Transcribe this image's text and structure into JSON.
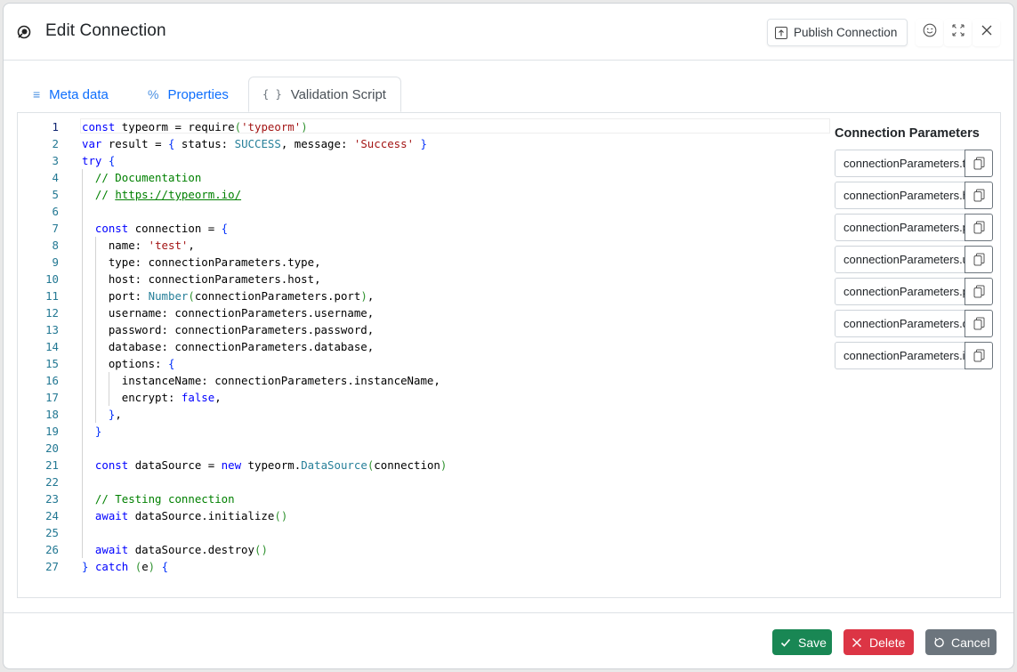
{
  "header": {
    "title": "Edit Connection",
    "title_icon": "connection-icon",
    "publish_label": "Publish Connection",
    "publish_icon": "upload-icon",
    "icons": [
      "smiley-icon",
      "fullscreen-icon",
      "close-icon"
    ]
  },
  "tabs": [
    {
      "label": "Meta data",
      "icon": "≡",
      "active": false
    },
    {
      "label": "Properties",
      "icon": "%",
      "active": false
    },
    {
      "label": "Validation Script",
      "icon": "{ }",
      "active": true
    }
  ],
  "editor": {
    "language": "javascript",
    "current_line": 1,
    "lines": [
      "const typeorm = require('typeorm')",
      "var result = { status: SUCCESS, message: 'Success' }",
      "try {",
      "  // Documentation",
      "  // https://typeorm.io/",
      "",
      "  const connection = {",
      "    name: 'test',",
      "    type: connectionParameters.type,",
      "    host: connectionParameters.host,",
      "    port: Number(connectionParameters.port),",
      "    username: connectionParameters.username,",
      "    password: connectionParameters.password,",
      "    database: connectionParameters.database,",
      "    options: {",
      "      instanceName: connectionParameters.instanceName,",
      "      encrypt: false,",
      "    },",
      "  }",
      "",
      "  const dataSource = new typeorm.DataSource(connection)",
      "",
      "  // Testing connection",
      "  await dataSource.initialize()",
      "",
      "  await dataSource.destroy()",
      "} catch (e) {"
    ]
  },
  "params": {
    "title": "Connection Parameters",
    "items": [
      "connectionParameters.type",
      "connectionParameters.host",
      "connectionParameters.port",
      "connectionParameters.username",
      "connectionParameters.password",
      "connectionParameters.database",
      "connectionParameters.instanceName"
    ]
  },
  "footer": {
    "save_label": "Save",
    "delete_label": "Delete",
    "cancel_label": "Cancel"
  },
  "colors": {
    "save": "#198754",
    "delete": "#dc3545",
    "cancel": "#6c757d",
    "tab_link": "#0d6efd"
  }
}
